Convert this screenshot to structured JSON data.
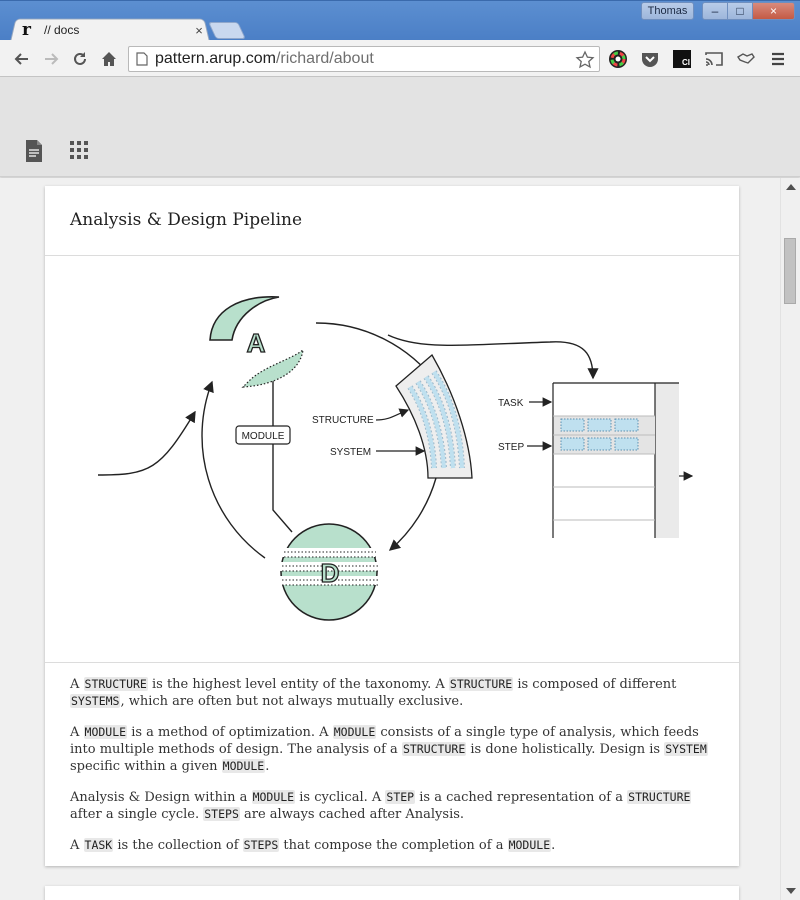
{
  "window": {
    "tab_title": "// docs",
    "tab_favicon_letter": "r",
    "tab_close": "×",
    "profile_name": "Thomas",
    "min_label": "–",
    "max_label": "□",
    "close_label": "×"
  },
  "toolbar": {
    "url_host": "pattern.arup.com",
    "url_path": "/richard/about"
  },
  "card": {
    "title": "Analysis & Design Pipeline"
  },
  "diagram": {
    "node_a_letter": "A",
    "node_d_letter": "D",
    "module_label": "MODULE",
    "structure_label": "STRUCTURE",
    "system_label": "SYSTEM",
    "task_label": "TASK",
    "step_label": "STEP",
    "accent_color": "#b8e0cc"
  },
  "prose": {
    "p1": [
      {
        "t": "A "
      },
      {
        "c": "STRUCTURE"
      },
      {
        "t": " is the highest level entity of the taxonomy. A "
      },
      {
        "c": "STRUCTURE"
      },
      {
        "t": " is composed of different "
      },
      {
        "c": "SYSTEMS"
      },
      {
        "t": ", which are often but not always mutually exclusive."
      }
    ],
    "p2": [
      {
        "t": "A "
      },
      {
        "c": "MODULE"
      },
      {
        "t": " is a method of optimization. A "
      },
      {
        "c": "MODULE"
      },
      {
        "t": " consists of a single type of analysis, which feeds into multiple methods of design. The analysis of a "
      },
      {
        "c": "STRUCTURE"
      },
      {
        "t": " is done holistically. Design is "
      },
      {
        "c": "SYSTEM"
      },
      {
        "t": " specific within a given "
      },
      {
        "c": "MODULE"
      },
      {
        "t": "."
      }
    ],
    "p3": [
      {
        "t": "Analysis & Design within a "
      },
      {
        "c": "MODULE"
      },
      {
        "t": " is cyclical. A "
      },
      {
        "c": "STEP"
      },
      {
        "t": " is a cached representation of a "
      },
      {
        "c": "STRUCTURE"
      },
      {
        "t": " after a single cycle. "
      },
      {
        "c": "STEPS"
      },
      {
        "t": " are always cached after Analysis."
      }
    ],
    "p4": [
      {
        "t": "A "
      },
      {
        "c": "TASK"
      },
      {
        "t": " is the collection of "
      },
      {
        "c": "STEPS"
      },
      {
        "t": " that compose the completion of a "
      },
      {
        "c": "MODULE"
      },
      {
        "t": "."
      }
    ]
  }
}
